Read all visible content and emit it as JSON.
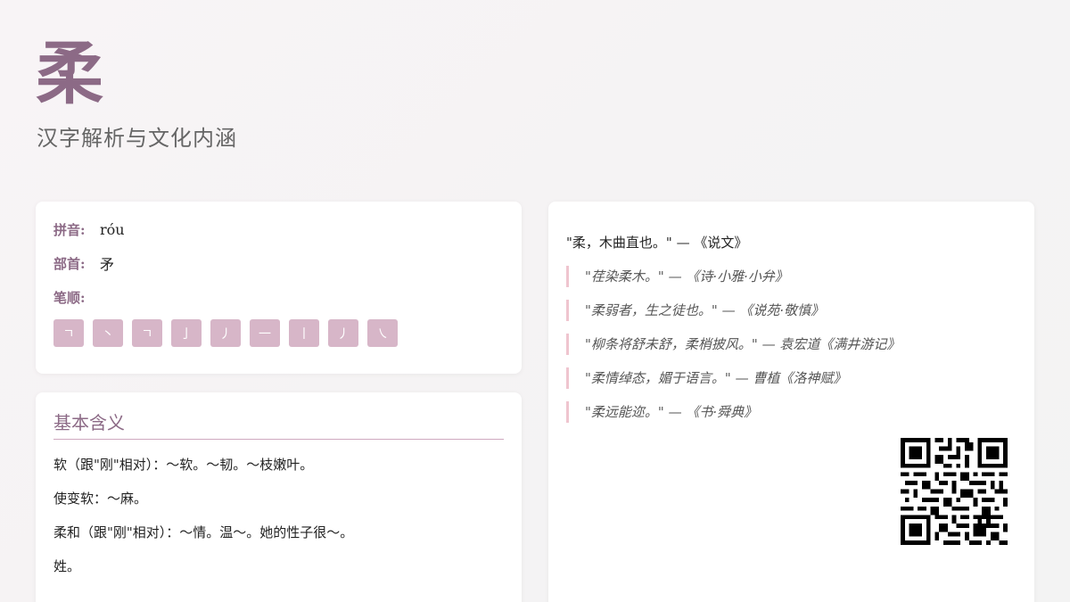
{
  "header": {
    "character": "柔",
    "subtitle": "汉字解析与文化内涵"
  },
  "info": {
    "pinyin_label": "拼音:",
    "pinyin_value": "róu",
    "radical_label": "部首:",
    "radical_value": "矛",
    "strokes_label": "笔顺:",
    "strokes": [
      "ㄱ",
      "丶",
      "ㄱ",
      "亅",
      "丿",
      "一",
      "丨",
      "丿",
      "㇏"
    ]
  },
  "meaning": {
    "title": "基本含义",
    "items": [
      "软（跟\"刚\"相对）：～软。～韧。～枝嫩叶。",
      "使变软：～麻。",
      "柔和（跟\"刚\"相对）：～情。温～。她的性子很～。",
      "姓。"
    ]
  },
  "quotes": {
    "main": "\"柔，木曲直也。\" — 《说文》",
    "items": [
      "\"荏染柔木。\" — 《诗·小雅·小弁》",
      "\"柔弱者，生之徒也。\" — 《说苑·敬慎》",
      "\"柳条将舒未舒，柔梢披风。\" — 袁宏道《满井游记》",
      "\"柔情绰态，媚于语言。\" — 曹植《洛神赋》",
      "\"柔远能迩。\" — 《书·舜典》"
    ]
  },
  "colors": {
    "accent": "#8c6a86",
    "stroke_tile": "#d7b6c8",
    "quote_border": "#efc5cf"
  },
  "icons": {
    "qr": "qr-code-icon"
  }
}
